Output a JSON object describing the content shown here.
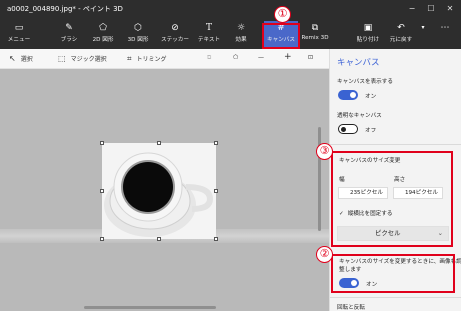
{
  "window": {
    "title": "a0002_004890.jpg* - ペイント 3D"
  },
  "ribbon": {
    "tools": [
      {
        "label": "メニュー",
        "icon": "folder-icon"
      },
      {
        "label": "ブラシ",
        "icon": "brush-icon"
      },
      {
        "label": "2D 図形",
        "icon": "shapes-2d-icon"
      },
      {
        "label": "3D 図形",
        "icon": "cube-icon"
      },
      {
        "label": "ステッカー",
        "icon": "sticker-icon"
      },
      {
        "label": "テキスト",
        "icon": "text-icon"
      },
      {
        "label": "効果",
        "icon": "effects-icon"
      },
      {
        "label": "キャンバス",
        "icon": "canvas-icon",
        "active": true
      },
      {
        "label": "Remix 3D",
        "icon": "remix3d-icon"
      },
      {
        "label": "貼り付け",
        "icon": "paste-icon"
      },
      {
        "label": "元に戻す",
        "icon": "undo-icon"
      }
    ],
    "annotation_1": "①"
  },
  "subtoolbar": {
    "select": "選択",
    "magic_select": "マジック選択",
    "crop": "トリミング"
  },
  "panel": {
    "title": "キャンバス",
    "show_canvas_label": "キャンバスを表示する",
    "show_canvas_state": "オン",
    "transparent_canvas_label": "透明なキャンバス",
    "transparent_canvas_state": "オフ",
    "resize_section": {
      "annotation": "③",
      "heading": "キャンバスのサイズ変更",
      "width_label": "幅",
      "height_label": "高さ",
      "width_value": "235ピクセル",
      "height_value": "194ピクセル",
      "lock_aspect_label": "縦横比を固定する",
      "unit_selected": "ピクセル"
    },
    "resize_image_section": {
      "annotation": "②",
      "label_line1": "キャンバスのサイズを変更するときに、画像も調",
      "label_line2": "整します",
      "state": "オン"
    },
    "rotate_flip_label": "回転と反転"
  },
  "colors": {
    "accent": "#3a63d2",
    "annotation_red": "#e0001b",
    "active_tab": "#4a68c9"
  }
}
